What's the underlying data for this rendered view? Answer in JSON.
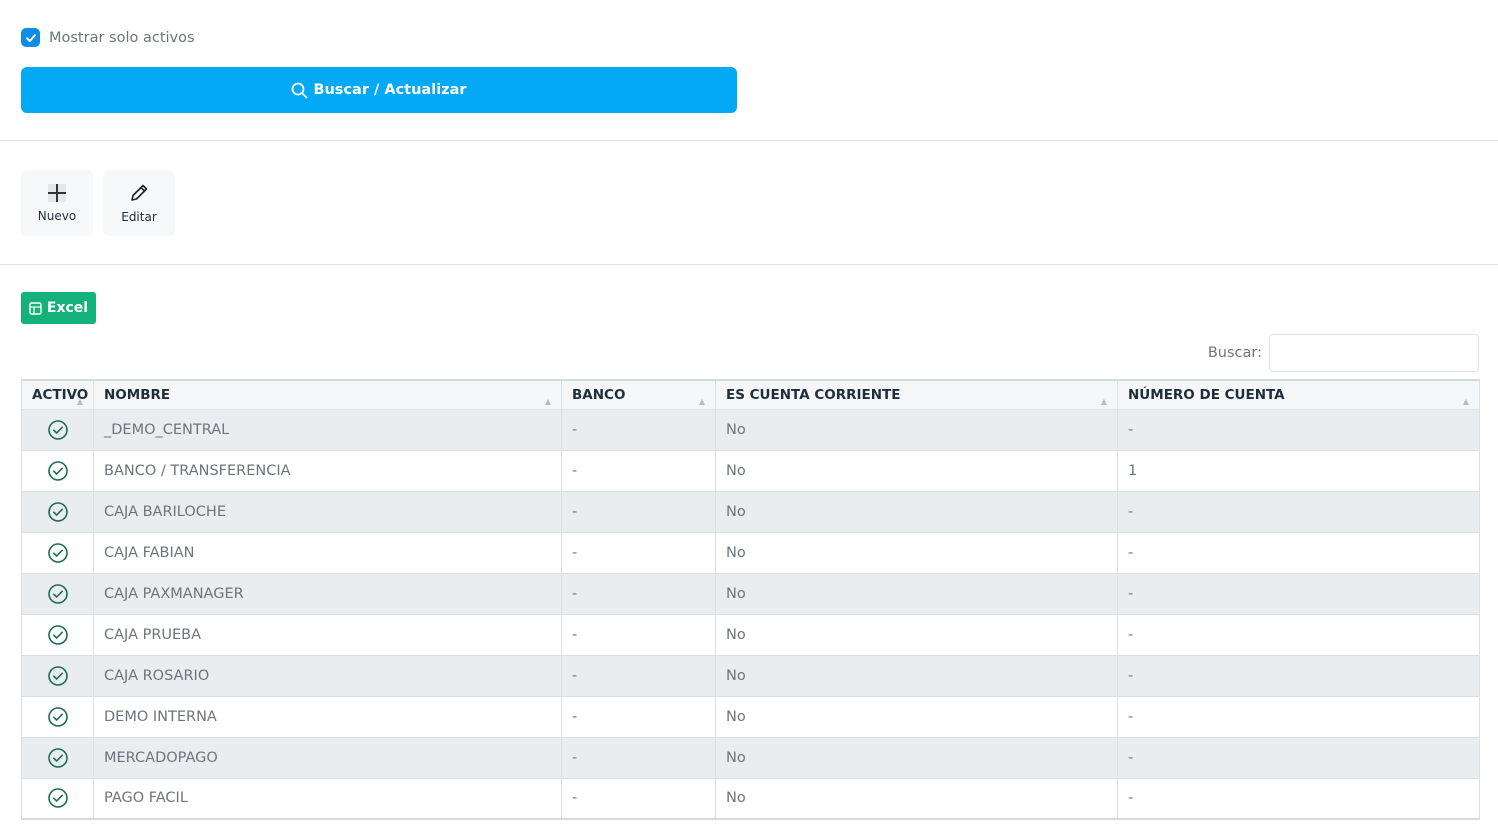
{
  "filter": {
    "label": "Mostrar solo activos",
    "checked": true
  },
  "search_button": {
    "label": "Buscar / Actualizar"
  },
  "toolbar": {
    "new_label": "Nuevo",
    "edit_label": "Editar"
  },
  "export": {
    "excel_label": "Excel"
  },
  "table_search": {
    "label": "Buscar:",
    "placeholder": ""
  },
  "table": {
    "headers": [
      "ACTIVO",
      "NOMBRE",
      "BANCO",
      "ES CUENTA CORRIENTE",
      "NÚMERO DE CUENTA"
    ],
    "rows": [
      [
        "_DEMO_CENTRAL",
        "-",
        "No",
        "-"
      ],
      [
        "BANCO / TRANSFERENCIA",
        "-",
        "No",
        "1"
      ],
      [
        "CAJA BARILOCHE",
        "-",
        "No",
        "-"
      ],
      [
        "CAJA FABIAN",
        "-",
        "No",
        "-"
      ],
      [
        "CAJA PAXMANAGER",
        "-",
        "No",
        "-"
      ],
      [
        "CAJA PRUEBA",
        "-",
        "No",
        "-"
      ],
      [
        "CAJA ROSARIO",
        "-",
        "No",
        "-"
      ],
      [
        "DEMO INTERNA",
        "-",
        "No",
        "-"
      ],
      [
        "MERCADOPAGO",
        "-",
        "No",
        "-"
      ],
      [
        "PAGO FACIL",
        "-",
        "No",
        "-"
      ]
    ]
  },
  "icons": {
    "check": "check-icon",
    "search": "search-icon",
    "plus": "plus-icon",
    "pencil": "pencil-icon",
    "excel": "excel-icon",
    "active": "check-circle-icon"
  },
  "colors": {
    "primary": "#03a9f4",
    "checkbox": "#0d8de6",
    "excel": "#14b17b",
    "active_icon": "#1e6b54"
  }
}
